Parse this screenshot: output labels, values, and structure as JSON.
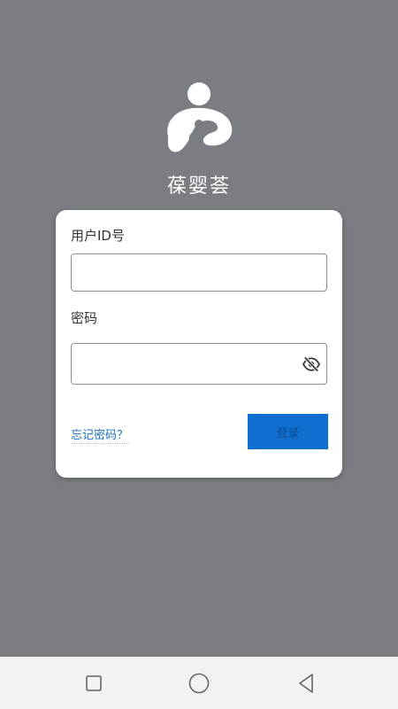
{
  "app": {
    "name": "葆婴荟"
  },
  "login_form": {
    "user_id_label": "用户ID号",
    "user_id_value": "",
    "user_id_placeholder": "",
    "password_label": "密码",
    "password_value": "",
    "password_placeholder": "",
    "forgot_password_link": "忘记密码？",
    "login_button": "登录"
  },
  "icons": {
    "logo": "mother-child-logo",
    "password_visibility": "eye-slash-icon",
    "nav_recents": "square-icon",
    "nav_home": "circle-icon",
    "nav_back": "triangle-back-icon"
  },
  "colors": {
    "background": "#7a7e82",
    "card": "#ffffff",
    "primary_button": "#0f6fcf",
    "link": "#1c6fbf",
    "nav_bar": "#f2f2f2"
  }
}
